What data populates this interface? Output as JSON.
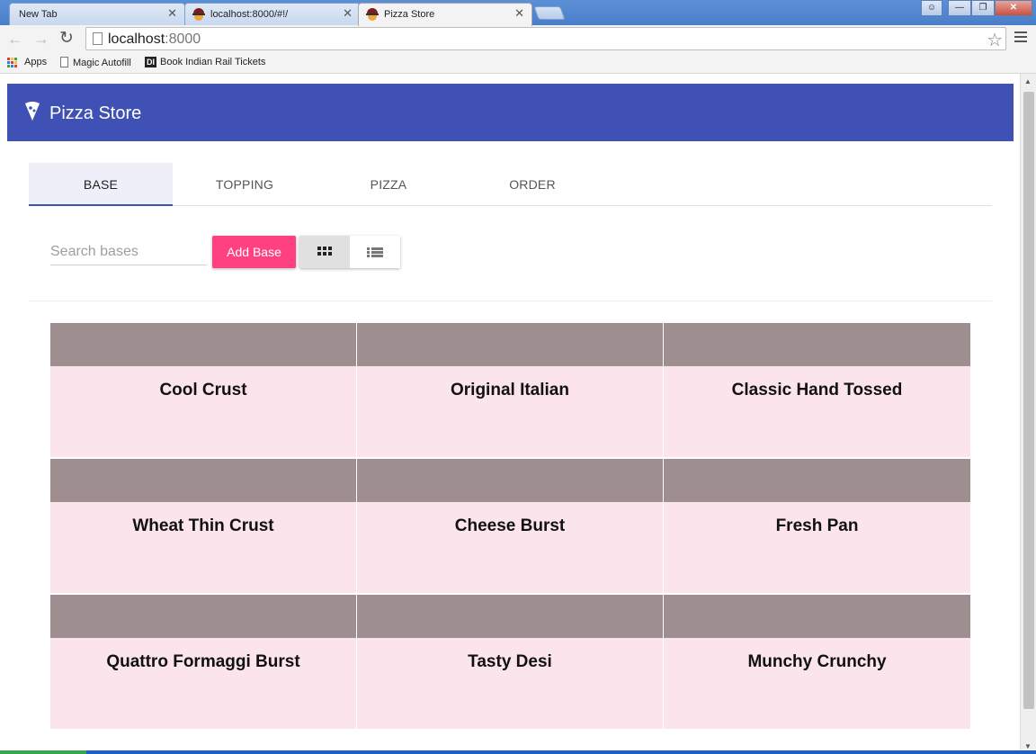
{
  "browser": {
    "tabs": [
      {
        "label": "New Tab"
      },
      {
        "label": "localhost:8000/#!/"
      },
      {
        "label": "Pizza Store"
      }
    ],
    "url": {
      "host": "localhost",
      "port": ":8000"
    },
    "bookmarks": [
      {
        "label": "Apps"
      },
      {
        "label": "Magic Autofill"
      },
      {
        "label": "Book Indian Rail Tickets"
      }
    ],
    "bookmark_di_label": "DI"
  },
  "app": {
    "title": "Pizza Store",
    "brand_color": "#3f51b5",
    "accent_color": "#ff4081"
  },
  "tabs": [
    {
      "label": "BASE",
      "selected": true
    },
    {
      "label": "TOPPING",
      "selected": false
    },
    {
      "label": "PIZZA",
      "selected": false
    },
    {
      "label": "ORDER",
      "selected": false
    }
  ],
  "controls": {
    "search_placeholder": "Search bases",
    "search_value": "",
    "add_label": "Add Base",
    "view_mode": "grid"
  },
  "bases": [
    {
      "name": "Cool Crust"
    },
    {
      "name": "Original Italian"
    },
    {
      "name": "Classic Hand Tossed"
    },
    {
      "name": "Wheat Thin Crust"
    },
    {
      "name": "Cheese Burst"
    },
    {
      "name": "Fresh Pan"
    },
    {
      "name": "Quattro Formaggi Burst"
    },
    {
      "name": "Tasty Desi"
    },
    {
      "name": "Munchy Crunchy"
    }
  ]
}
